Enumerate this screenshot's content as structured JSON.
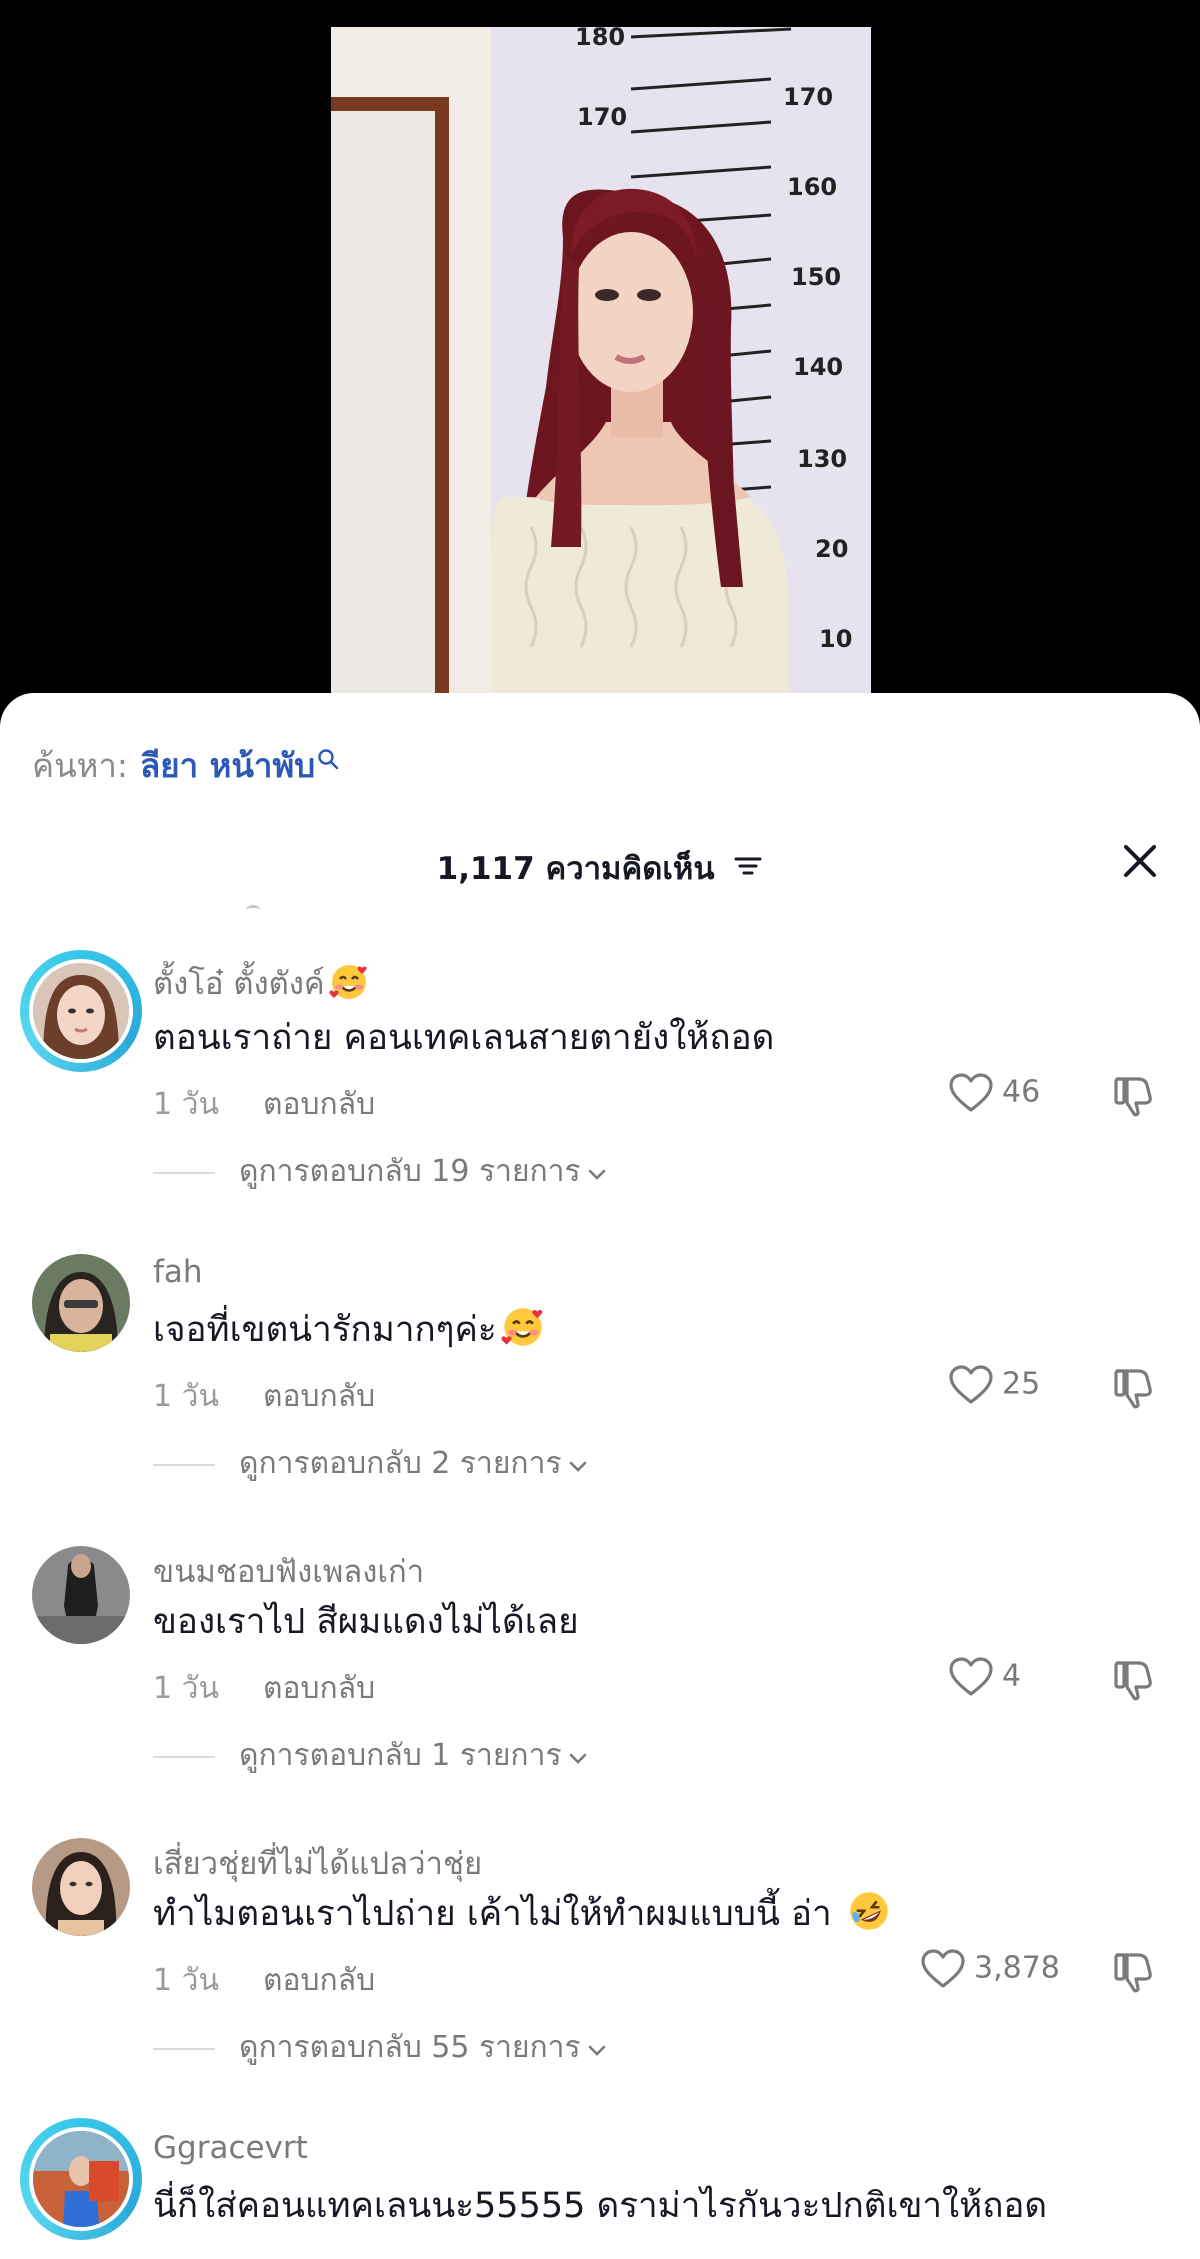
{
  "video": {
    "ruler_marks": [
      "180",
      "170",
      "170",
      "160",
      "160",
      "150",
      "140",
      "130",
      "20",
      "10"
    ]
  },
  "search": {
    "label": "ค้นหา:",
    "term": "ลียา หน้าพับ",
    "icon": "search-icon"
  },
  "header": {
    "count_title": "1,117 ความคิดเห็น",
    "sort_icon": "sort-icon",
    "close_icon": "close-icon"
  },
  "comments": [
    {
      "username": "ตั้งโอ๋ ตั้งตังค์",
      "username_emoji": "smiling-face-with-hearts",
      "text": "ตอนเราถ่าย คอนเทคเลนสายตายังให้ถอด",
      "time": "1 วัน",
      "reply_label": "ตอบกลับ",
      "likes": "46",
      "view_replies": "ดูการตอบกลับ 19 รายการ"
    },
    {
      "username": "fah",
      "text": "เจอที่เขตน่ารักมากๆค่ะ",
      "text_emoji": "smiling-face-with-hearts",
      "time": "1 วัน",
      "reply_label": "ตอบกลับ",
      "likes": "25",
      "view_replies": "ดูการตอบกลับ 2 รายการ"
    },
    {
      "username": "ขนมชอบฟังเพลงเก่า",
      "text": "ของเราไป สีผมแดงไม่ได้เลย",
      "time": "1 วัน",
      "reply_label": "ตอบกลับ",
      "likes": "4",
      "view_replies": "ดูการตอบกลับ 1 รายการ"
    },
    {
      "username": "เสี่ยวชุ่ยที่ไม่ได้แปลว่าชุ่ย",
      "text": "ทำไมตอนเราไปถ่าย เค้าไม่ให้ทำผมแบบนี้ อ่า",
      "text_emoji": "rolling-on-the-floor-laughing",
      "time": "1 วัน",
      "reply_label": "ตอบกลับ",
      "likes": "3,878",
      "view_replies": "ดูการตอบกลับ 55 รายการ"
    },
    {
      "username": "Ggracevrt",
      "text": "นี่ก็ใส่คอนแทคเลนนะ55555 ดราม่าไรกันวะปกติเขาให้ถอด"
    }
  ],
  "colors": {
    "sheet_bg": "#ffffff",
    "text_primary": "#161823",
    "text_secondary": "#7a7a7a",
    "link_blue": "#2c58b6",
    "story_ring": "#35c8e8"
  }
}
